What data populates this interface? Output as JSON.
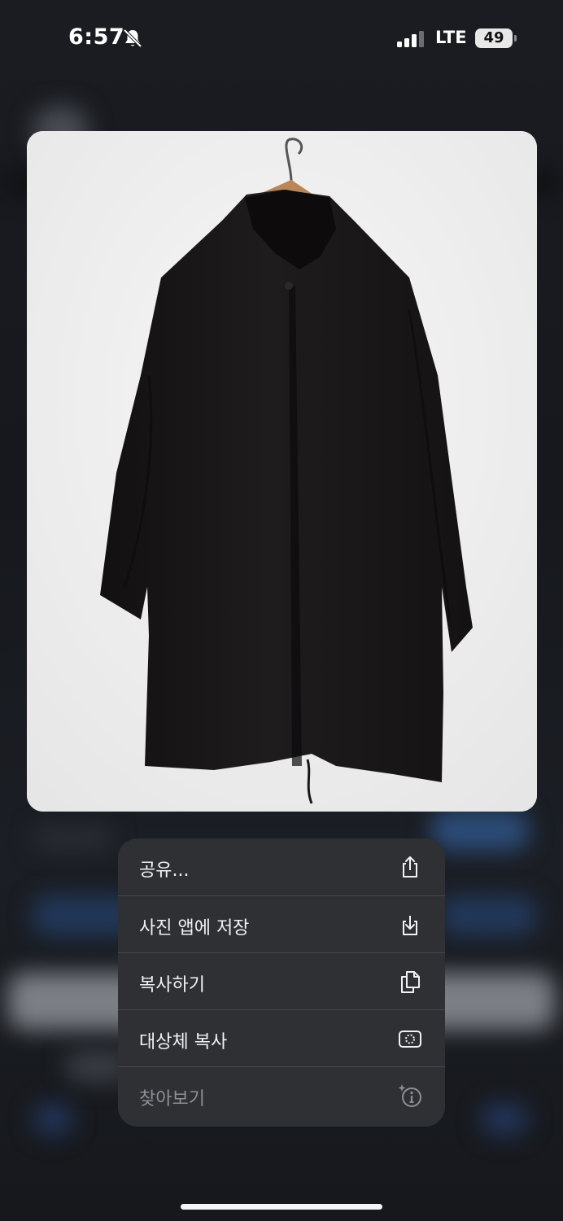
{
  "status_bar": {
    "time": "6:57",
    "network": "LTE",
    "battery": "49",
    "silent_icon": "bell-slash-icon",
    "signal_icon": "cellular-signal-icon"
  },
  "preview": {
    "image_icon": "photo-of-black-coat-on-hanger",
    "background_color": "#f1f1f1",
    "garment_color": "#1b1819"
  },
  "menu": {
    "items": [
      {
        "label": "공유...",
        "icon": "share-icon"
      },
      {
        "label": "사진 앱에 저장",
        "icon": "save-to-photos-icon"
      },
      {
        "label": "복사하기",
        "icon": "copy-icon"
      },
      {
        "label": "대상체 복사",
        "icon": "copy-subject-icon"
      },
      {
        "label": "찾아보기",
        "icon": "visual-lookup-icon"
      }
    ],
    "background_color": "#2f3034"
  }
}
